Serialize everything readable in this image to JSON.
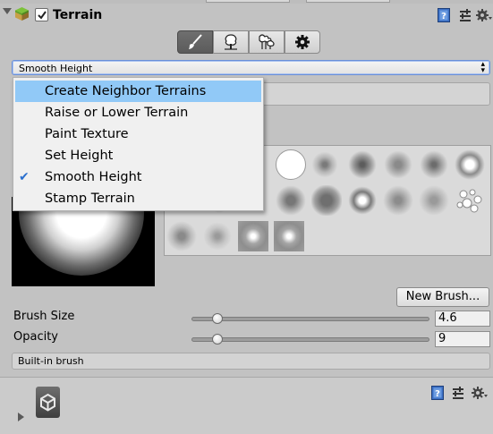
{
  "component": {
    "title": "Terrain",
    "enabled": true
  },
  "tools": [
    {
      "icon": "paintbrush-icon",
      "active": true
    },
    {
      "icon": "tree-icon",
      "active": false
    },
    {
      "icon": "grass-icon",
      "active": false
    },
    {
      "icon": "gear-icon",
      "active": false
    }
  ],
  "dropdown": {
    "selected": "Smooth Height",
    "options": [
      {
        "label": "Create Neighbor Terrains",
        "highlighted": true,
        "checked": false
      },
      {
        "label": "Raise or Lower Terrain",
        "highlighted": false,
        "checked": false
      },
      {
        "label": "Paint Texture",
        "highlighted": false,
        "checked": false
      },
      {
        "label": "Set Height",
        "highlighted": false,
        "checked": false
      },
      {
        "label": "Smooth Height",
        "highlighted": false,
        "checked": true
      },
      {
        "label": "Stamp Terrain",
        "highlighted": false,
        "checked": false
      }
    ]
  },
  "brushes": {
    "new_button": "New Brush..."
  },
  "settings": {
    "brush_size": {
      "label": "Brush Size",
      "value": "4.6",
      "slider_fraction": 0.11
    },
    "opacity": {
      "label": "Opacity",
      "value": "9",
      "slider_fraction": 0.11
    }
  },
  "help_text": "Built-in brush",
  "colors": {
    "highlight": "#91c9f7",
    "panel": "#c2c2c2",
    "active_tool": "#5f5f5f"
  }
}
